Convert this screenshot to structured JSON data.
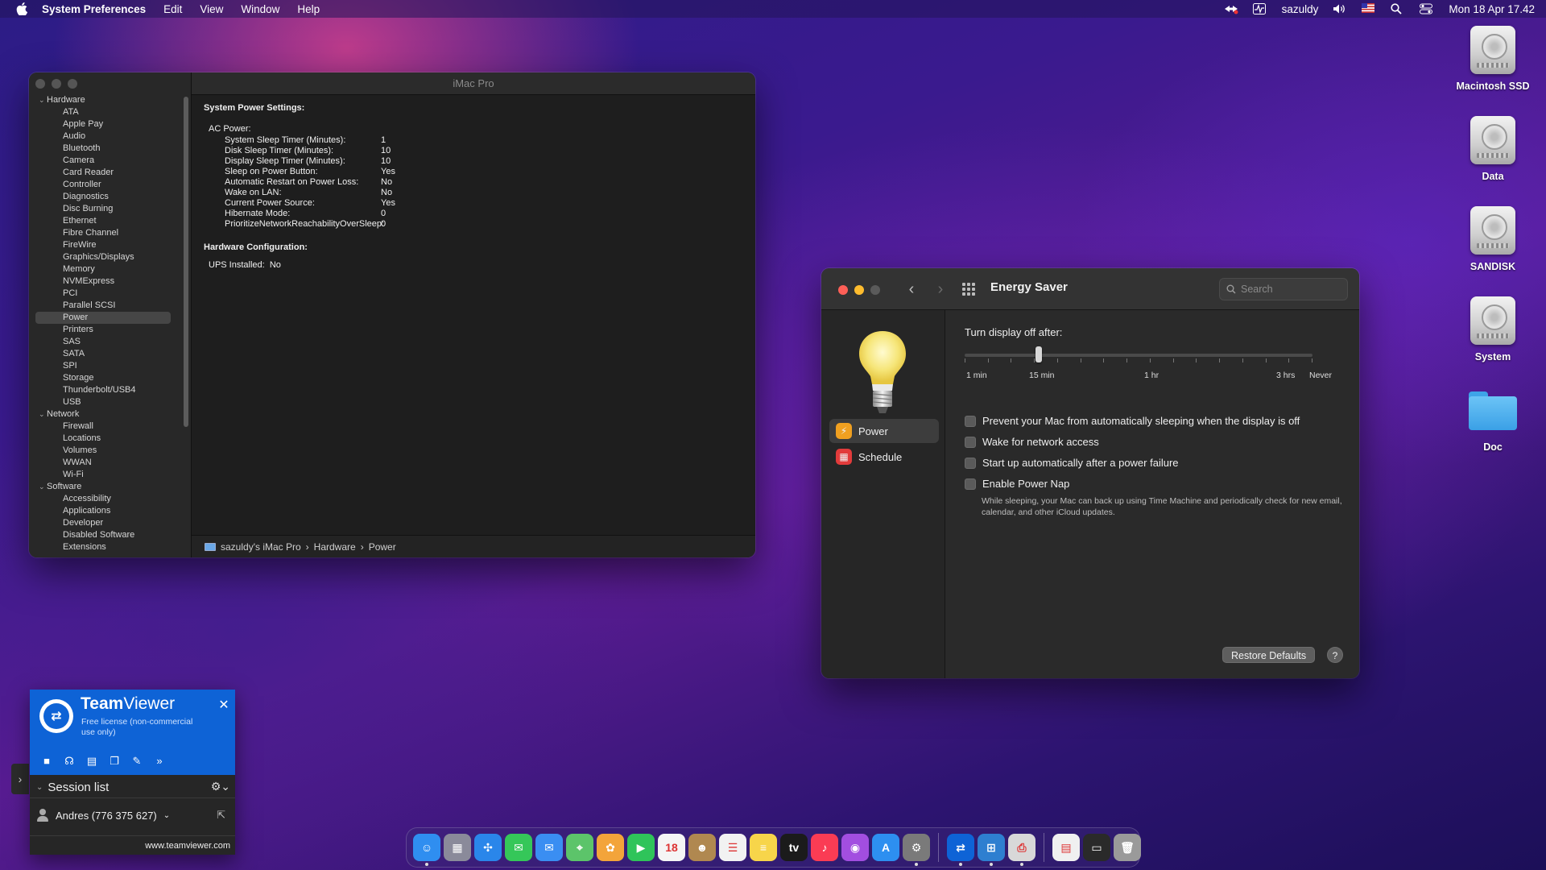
{
  "menubar": {
    "app_name": "System Preferences",
    "menus": [
      "Edit",
      "View",
      "Window",
      "Help"
    ],
    "user": "sazuldy",
    "datetime": "Mon 18 Apr  17.42"
  },
  "sysinfo": {
    "title": "iMac Pro",
    "tree": [
      {
        "type": "group",
        "label": "Hardware"
      },
      {
        "type": "leaf",
        "label": "ATA"
      },
      {
        "type": "leaf",
        "label": "Apple Pay"
      },
      {
        "type": "leaf",
        "label": "Audio"
      },
      {
        "type": "leaf",
        "label": "Bluetooth"
      },
      {
        "type": "leaf",
        "label": "Camera"
      },
      {
        "type": "leaf",
        "label": "Card Reader"
      },
      {
        "type": "leaf",
        "label": "Controller"
      },
      {
        "type": "leaf",
        "label": "Diagnostics"
      },
      {
        "type": "leaf",
        "label": "Disc Burning"
      },
      {
        "type": "leaf",
        "label": "Ethernet"
      },
      {
        "type": "leaf",
        "label": "Fibre Channel"
      },
      {
        "type": "leaf",
        "label": "FireWire"
      },
      {
        "type": "leaf",
        "label": "Graphics/Displays"
      },
      {
        "type": "leaf",
        "label": "Memory"
      },
      {
        "type": "leaf",
        "label": "NVMExpress"
      },
      {
        "type": "leaf",
        "label": "PCI"
      },
      {
        "type": "leaf",
        "label": "Parallel SCSI"
      },
      {
        "type": "leaf",
        "label": "Power",
        "selected": true
      },
      {
        "type": "leaf",
        "label": "Printers"
      },
      {
        "type": "leaf",
        "label": "SAS"
      },
      {
        "type": "leaf",
        "label": "SATA"
      },
      {
        "type": "leaf",
        "label": "SPI"
      },
      {
        "type": "leaf",
        "label": "Storage"
      },
      {
        "type": "leaf",
        "label": "Thunderbolt/USB4"
      },
      {
        "type": "leaf",
        "label": "USB"
      },
      {
        "type": "group",
        "label": "Network"
      },
      {
        "type": "leaf",
        "label": "Firewall"
      },
      {
        "type": "leaf",
        "label": "Locations"
      },
      {
        "type": "leaf",
        "label": "Volumes"
      },
      {
        "type": "leaf",
        "label": "WWAN"
      },
      {
        "type": "leaf",
        "label": "Wi-Fi"
      },
      {
        "type": "group",
        "label": "Software"
      },
      {
        "type": "leaf",
        "label": "Accessibility"
      },
      {
        "type": "leaf",
        "label": "Applications"
      },
      {
        "type": "leaf",
        "label": "Developer"
      },
      {
        "type": "leaf",
        "label": "Disabled Software"
      },
      {
        "type": "leaf",
        "label": "Extensions"
      }
    ],
    "heading1": "System Power Settings:",
    "ac_power_label": "AC Power:",
    "settings": [
      {
        "key": "System Sleep Timer (Minutes):",
        "value": "1"
      },
      {
        "key": "Disk Sleep Timer (Minutes):",
        "value": "10"
      },
      {
        "key": "Display Sleep Timer (Minutes):",
        "value": "10"
      },
      {
        "key": "Sleep on Power Button:",
        "value": "Yes"
      },
      {
        "key": "Automatic Restart on Power Loss:",
        "value": "No"
      },
      {
        "key": "Wake on LAN:",
        "value": "No"
      },
      {
        "key": "Current Power Source:",
        "value": "Yes"
      },
      {
        "key": "Hibernate Mode:",
        "value": "0"
      },
      {
        "key": "PrioritizeNetworkReachabilityOverSleep:",
        "value": "0"
      }
    ],
    "heading2": "Hardware Configuration:",
    "ups_label": "UPS Installed:",
    "ups_value": "No",
    "breadcrumb": [
      "sazuldy's iMac Pro",
      "Hardware",
      "Power"
    ]
  },
  "energy": {
    "title": "Energy Saver",
    "search_placeholder": "Search",
    "sidebar": [
      {
        "label": "Power",
        "icon": "power-bolt-icon",
        "color": "#f0a020",
        "selected": true
      },
      {
        "label": "Schedule",
        "icon": "calendar-icon",
        "color": "#e23b3b",
        "selected": false
      }
    ],
    "display_off_label": "Turn display off after:",
    "slider_value": "15 min",
    "slider_labels": [
      "1 min",
      "15 min",
      "1 hr",
      "3 hrs",
      "Never"
    ],
    "options": [
      {
        "label": "Prevent your Mac from automatically sleeping when the display is off",
        "checked": false
      },
      {
        "label": "Wake for network access",
        "checked": false
      },
      {
        "label": "Start up automatically after a power failure",
        "checked": false
      },
      {
        "label": "Enable Power Nap",
        "checked": false
      }
    ],
    "power_nap_note": "While sleeping, your Mac can back up using Time Machine and periodically check for new email, calendar, and other iCloud updates.",
    "restore_label": "Restore Defaults",
    "help_label": "?"
  },
  "desktop_icons": [
    {
      "label": "Macintosh SSD",
      "kind": "disk"
    },
    {
      "label": "Data",
      "kind": "disk"
    },
    {
      "label": "SANDISK",
      "kind": "disk"
    },
    {
      "label": "System",
      "kind": "disk"
    },
    {
      "label": "Doc",
      "kind": "folder"
    }
  ],
  "teamviewer": {
    "brand_bold": "Team",
    "brand_light": "Viewer",
    "license": "Free license (non-commercial use only)",
    "session_list": "Session list",
    "contact": "Andres (776 375 627)",
    "footer": "www.teamviewer.com"
  },
  "dock": {
    "apps": [
      {
        "name": "finder",
        "color": "#2f8ef0",
        "glyph": "☺",
        "running": true
      },
      {
        "name": "launchpad",
        "color": "#8a8a9a",
        "glyph": "▦",
        "running": false
      },
      {
        "name": "safari",
        "color": "#2a86ea",
        "glyph": "✣",
        "running": false
      },
      {
        "name": "messages",
        "color": "#35c759",
        "glyph": "✉",
        "running": false
      },
      {
        "name": "mail",
        "color": "#3a8ef2",
        "glyph": "✉",
        "running": false
      },
      {
        "name": "maps",
        "color": "#5cc46a",
        "glyph": "⌖",
        "running": false
      },
      {
        "name": "photos",
        "color": "#f3a43a",
        "glyph": "✿",
        "running": false
      },
      {
        "name": "facetime",
        "color": "#2fc45a",
        "glyph": "▶",
        "running": false
      },
      {
        "name": "calendar",
        "color": "#f5f5f5",
        "glyph": "18",
        "running": false
      },
      {
        "name": "contacts",
        "color": "#b08850",
        "glyph": "☻",
        "running": false
      },
      {
        "name": "reminders",
        "color": "#f2f2f2",
        "glyph": "☰",
        "running": false
      },
      {
        "name": "notes",
        "color": "#f7d54a",
        "glyph": "≡",
        "running": false
      },
      {
        "name": "apple-tv",
        "color": "#1b1b1b",
        "glyph": "tv",
        "running": false
      },
      {
        "name": "music",
        "color": "#fa3c54",
        "glyph": "♪",
        "running": false
      },
      {
        "name": "podcasts",
        "color": "#a24ee0",
        "glyph": "◉",
        "running": false
      },
      {
        "name": "app-store",
        "color": "#2d8ff0",
        "glyph": "A",
        "running": false
      },
      {
        "name": "system-preferences",
        "color": "#7a7a7a",
        "glyph": "⚙",
        "running": true
      },
      {
        "name": "sep",
        "color": "",
        "glyph": "",
        "running": false
      },
      {
        "name": "teamviewer",
        "color": "#0e63d6",
        "glyph": "⇄",
        "running": true
      },
      {
        "name": "system-information",
        "color": "#2e7fd0",
        "glyph": "⊞",
        "running": true
      },
      {
        "name": "printer",
        "color": "#d8d8d8",
        "glyph": "⎙",
        "running": true
      },
      {
        "name": "sep2",
        "color": "",
        "glyph": "",
        "running": false
      },
      {
        "name": "document",
        "color": "#f0f0f0",
        "glyph": "▤",
        "running": false
      },
      {
        "name": "screen",
        "color": "#2a2a2a",
        "glyph": "▭",
        "running": false
      },
      {
        "name": "trash",
        "color": "#9a9a9a",
        "glyph": "🗑",
        "running": false
      }
    ]
  }
}
